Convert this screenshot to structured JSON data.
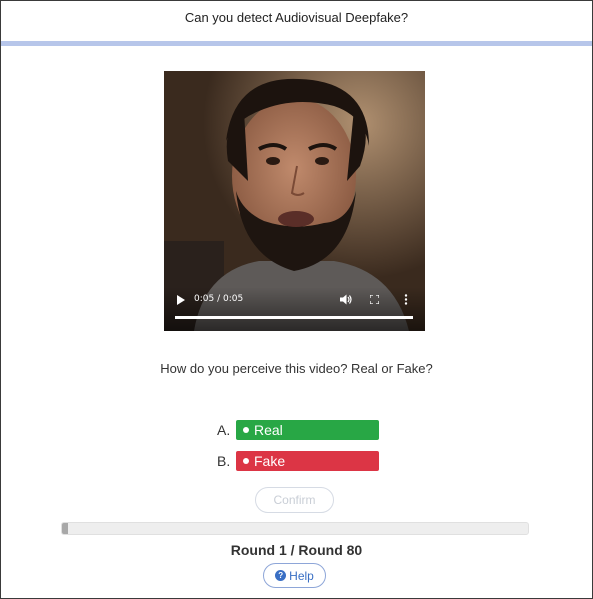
{
  "header": {
    "title": "Can you detect Audiovisual Deepfake?",
    "accent_color": "#b7c6ea"
  },
  "video": {
    "time_display": "0:05 / 0:05",
    "progress_fraction": 1.0,
    "icons": [
      "play-icon",
      "volume-icon",
      "fullscreen-icon",
      "more-options-icon"
    ]
  },
  "question": "How do you perceive this video? Real or Fake?",
  "options": [
    {
      "letter": "A.",
      "label": "Real",
      "color": "#28a745"
    },
    {
      "letter": "B.",
      "label": "Fake",
      "color": "#dc3545"
    }
  ],
  "confirm_label": "Confirm",
  "progress": {
    "current": 1,
    "total": 80
  },
  "round_text": "Round 1 / Round 80",
  "help_label": "Help"
}
